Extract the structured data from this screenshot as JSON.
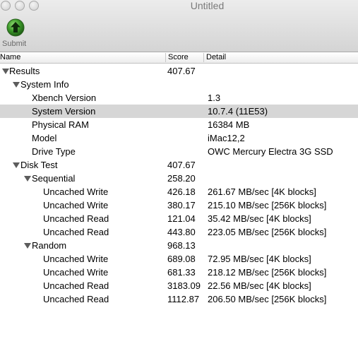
{
  "window": {
    "title": "Untitled"
  },
  "toolbar": {
    "submit_label": "Submit"
  },
  "columns": {
    "name": "Name",
    "score": "Score",
    "detail": "Detail"
  },
  "rows": [
    {
      "name": "Results",
      "score": "407.67",
      "detail": "",
      "level": 0,
      "expandable": true,
      "selected": false
    },
    {
      "name": "System Info",
      "score": "",
      "detail": "",
      "level": 1,
      "expandable": true,
      "selected": false
    },
    {
      "name": "Xbench Version",
      "score": "",
      "detail": "1.3",
      "level": 2,
      "expandable": false,
      "selected": false
    },
    {
      "name": "System Version",
      "score": "",
      "detail": "10.7.4 (11E53)",
      "level": 2,
      "expandable": false,
      "selected": true
    },
    {
      "name": "Physical RAM",
      "score": "",
      "detail": "16384 MB",
      "level": 2,
      "expandable": false,
      "selected": false
    },
    {
      "name": "Model",
      "score": "",
      "detail": "iMac12,2",
      "level": 2,
      "expandable": false,
      "selected": false
    },
    {
      "name": "Drive Type",
      "score": "",
      "detail": "OWC Mercury Electra 3G SSD",
      "level": 2,
      "expandable": false,
      "selected": false
    },
    {
      "name": "Disk Test",
      "score": "407.67",
      "detail": "",
      "level": 1,
      "expandable": true,
      "selected": false
    },
    {
      "name": "Sequential",
      "score": "258.20",
      "detail": "",
      "level": 2,
      "expandable": true,
      "selected": false
    },
    {
      "name": "Uncached Write",
      "score": "426.18",
      "detail": "261.67 MB/sec [4K blocks]",
      "level": 3,
      "expandable": false,
      "selected": false
    },
    {
      "name": "Uncached Write",
      "score": "380.17",
      "detail": "215.10 MB/sec [256K blocks]",
      "level": 3,
      "expandable": false,
      "selected": false
    },
    {
      "name": "Uncached Read",
      "score": "121.04",
      "detail": "35.42 MB/sec [4K blocks]",
      "level": 3,
      "expandable": false,
      "selected": false
    },
    {
      "name": "Uncached Read",
      "score": "443.80",
      "detail": "223.05 MB/sec [256K blocks]",
      "level": 3,
      "expandable": false,
      "selected": false
    },
    {
      "name": "Random",
      "score": "968.13",
      "detail": "",
      "level": 2,
      "expandable": true,
      "selected": false
    },
    {
      "name": "Uncached Write",
      "score": "689.08",
      "detail": "72.95 MB/sec [4K blocks]",
      "level": 3,
      "expandable": false,
      "selected": false
    },
    {
      "name": "Uncached Write",
      "score": "681.33",
      "detail": "218.12 MB/sec [256K blocks]",
      "level": 3,
      "expandable": false,
      "selected": false
    },
    {
      "name": "Uncached Read",
      "score": "3183.09",
      "detail": "22.56 MB/sec [4K blocks]",
      "level": 3,
      "expandable": false,
      "selected": false
    },
    {
      "name": "Uncached Read",
      "score": "1112.87",
      "detail": "206.50 MB/sec [256K blocks]",
      "level": 3,
      "expandable": false,
      "selected": false
    }
  ]
}
